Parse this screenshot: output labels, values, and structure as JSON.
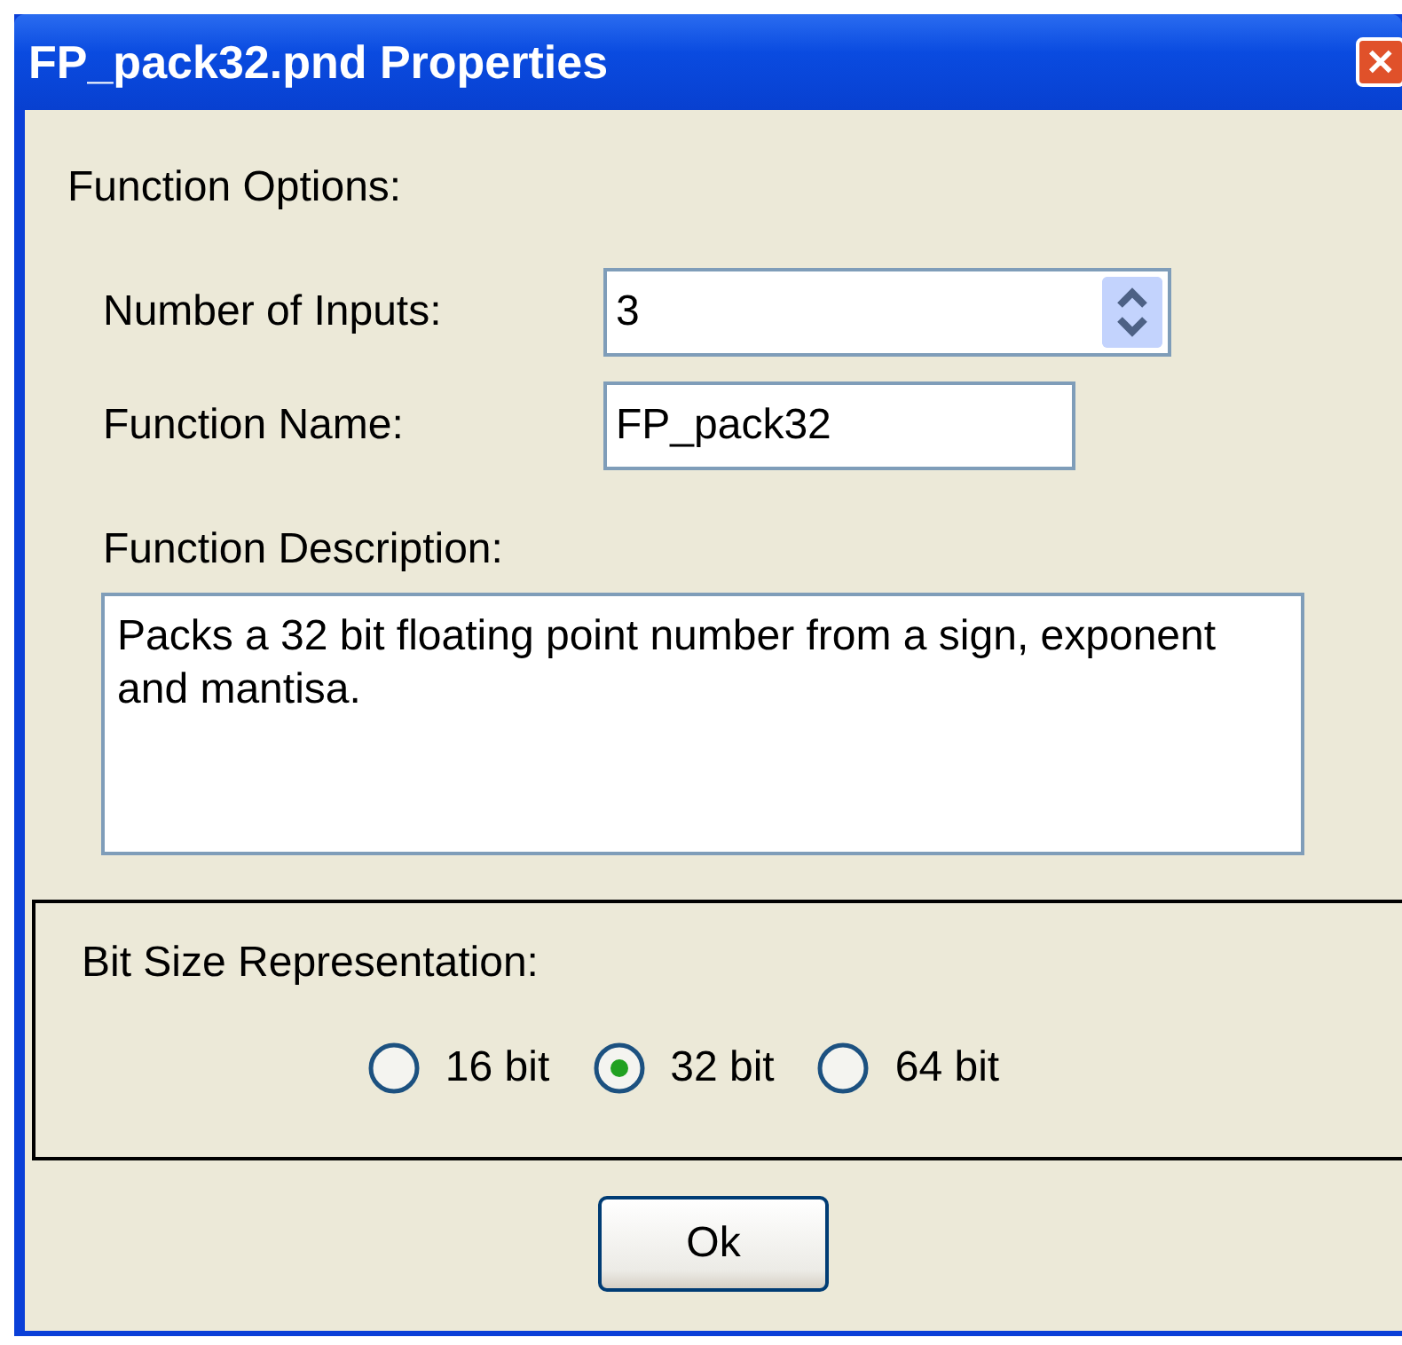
{
  "window": {
    "title": "FP_pack32.pnd Properties",
    "close": "✕"
  },
  "function_options": {
    "heading": "Function Options:",
    "number_of_inputs": {
      "label": "Number of Inputs:",
      "value": "3"
    },
    "function_name": {
      "label": "Function Name:",
      "value": "FP_pack32"
    },
    "function_description": {
      "label": "Function Description:",
      "value": "Packs a 32 bit floating point number from a sign, exponent and mantisa."
    }
  },
  "bit_size": {
    "heading": "Bit Size Representation:",
    "options": [
      {
        "label": "16 bit",
        "selected": false
      },
      {
        "label": "32 bit",
        "selected": true
      },
      {
        "label": "64 bit",
        "selected": false
      }
    ]
  },
  "buttons": [
    "Ok"
  ]
}
